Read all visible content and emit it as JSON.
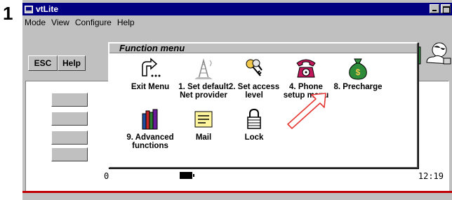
{
  "step": "1",
  "window": {
    "title": "vtLite"
  },
  "menubar": [
    "Mode",
    "View",
    "Configure",
    "Help"
  ],
  "toolbar": {
    "esc": "ESC",
    "help": "Help"
  },
  "function_menu": {
    "title": "Function menu",
    "items": [
      {
        "label_1": "Exit Menu",
        "label_2": "",
        "icon": "exit-arrow-icon"
      },
      {
        "label_1": "1. Set default",
        "label_2": "Net provider",
        "icon": "antenna-tower-icon"
      },
      {
        "label_1": "2. Set access",
        "label_2": "level",
        "icon": "keys-icon"
      },
      {
        "label_1": "4. Phone",
        "label_2": "setup menu",
        "icon": "telephone-icon"
      },
      {
        "label_1": "8. Precharge",
        "label_2": "",
        "icon": "money-bag-icon"
      },
      {
        "label_1": "9. Advanced",
        "label_2": "functions",
        "icon": "books-icon"
      },
      {
        "label_1": "Mail",
        "label_2": "",
        "icon": "mail-icon"
      },
      {
        "label_1": "Lock",
        "label_2": "",
        "icon": "padlock-icon"
      }
    ]
  },
  "status": {
    "left_value": "0",
    "time": "12:19"
  },
  "colors": {
    "titlebar": "#000080",
    "accent_red": "#c00000",
    "bag_green": "#2e8b3a"
  }
}
